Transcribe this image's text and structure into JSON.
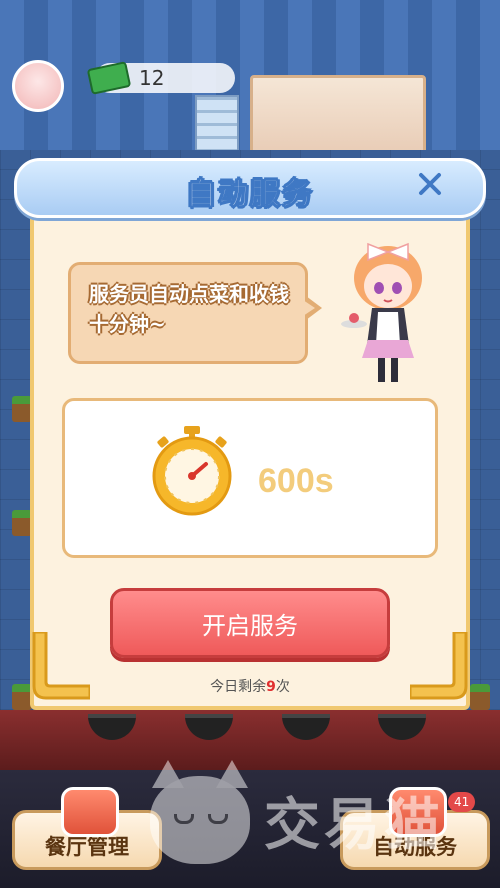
{
  "hud": {
    "coins": "12"
  },
  "modal": {
    "title": "自动服务",
    "speech": "服务员自动点菜和收钱十分钟~",
    "timer_value": "600s",
    "start_label": "开启服务",
    "remaining_prefix": "今日剩余",
    "remaining_count": "9",
    "remaining_suffix": "次"
  },
  "bottom": {
    "left_button": "餐厅管理",
    "right_button": "自动服务",
    "badge": "41"
  },
  "watermark": "交易猫",
  "colors": {
    "accent_red": "#ef5a5a",
    "header_blue": "#a9ccf3",
    "panel_cream": "#fdf2df"
  },
  "icons": [
    "close-icon",
    "stopwatch-icon",
    "money-icon"
  ]
}
